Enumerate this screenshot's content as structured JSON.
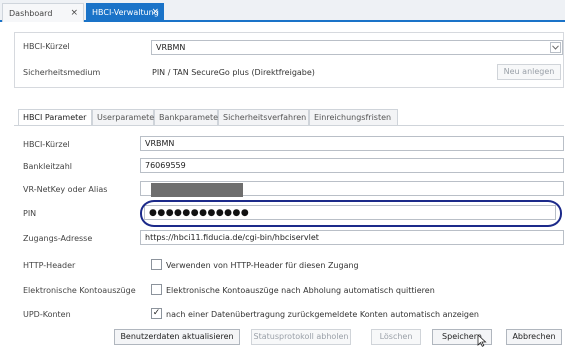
{
  "doc_tabs": [
    {
      "label": "Dashboard",
      "close": "×"
    },
    {
      "label": "HBCI-Verwaltung",
      "close": "×"
    }
  ],
  "top": {
    "kuerzel_label": "HBCI-Kürzel",
    "kuerzel_value": "VRBMN",
    "medium_label": "Sicherheitsmedium",
    "medium_value": "PIN / TAN   SecureGo plus (Direktfreigabe)",
    "new_button": "Neu anlegen"
  },
  "inner_tabs": [
    "HBCI Parameter",
    "Userparameter",
    "Bankparameter",
    "Sicherheitsverfahren",
    "Einreichungsfristen"
  ],
  "form": {
    "kuerzel_label": "HBCI-Kürzel",
    "kuerzel_value": "VRBMN",
    "blz_label": "Bankleitzahl",
    "blz_value": "76069559",
    "netkey_label": "VR-NetKey oder Alias",
    "pin_label": "PIN",
    "pin_value": "●●●●●●●●●●●●",
    "address_label": "Zugangs-Adresse",
    "address_value": "https://hbci11.fiducia.de/cgi-bin/hbciservlet",
    "header_label": "HTTP-Header",
    "header_option": "Verwenden von HTTP-Header für diesen Zugang",
    "statement_label": "Elektronische Kontoauszüge",
    "statement_option": "Elektronische Kontoauszüge nach Abholung automatisch quittieren",
    "upd_label": "UPD-Konten",
    "upd_option": "nach einer Datenübertragung zurückgemeldete Konten automatisch anzeigen",
    "check_mark": "✓"
  },
  "buttons": {
    "update": "Benutzerdaten aktualisieren",
    "protocol": "Statusprotokoll abholen",
    "delete": "Löschen",
    "save": "Speichern",
    "cancel": "Abbrechen"
  },
  "icons": {
    "dropdown": "chevron-down-icon",
    "pointer": "mouse-pointer-icon"
  },
  "colors": {
    "accent": "#1a73c8",
    "highlight": "#1c2a8a"
  }
}
